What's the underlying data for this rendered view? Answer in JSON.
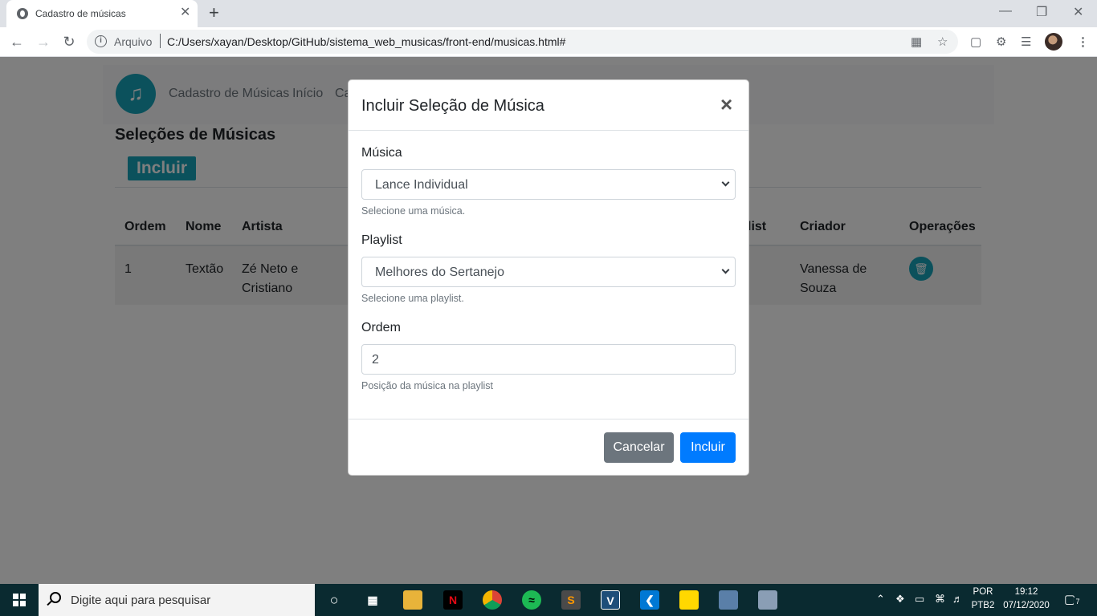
{
  "browser": {
    "tab_title": "Cadastro de músicas",
    "tab_close": "✕",
    "new_tab": "+",
    "scheme_label": "Arquivo",
    "url": "C:/Users/xayan/Desktop/GitHub/sistema_web_musicas/front-end/musicas.html#"
  },
  "navbar": {
    "brand": "Cadastro de Músicas",
    "link_inicio": "Início",
    "link_partial": "Ca"
  },
  "page": {
    "title": "Seleções de Músicas",
    "incluir_button": "Incluir"
  },
  "table": {
    "headers": [
      "Ordem",
      "Nome",
      "Artista",
      "list",
      "Criador",
      "Operações"
    ],
    "rows": [
      {
        "ordem": "1",
        "nome": "Textão",
        "artista_l1": "Zé Neto e",
        "artista_l2": "Cristiano",
        "criador_l1": "Vanessa de",
        "criador_l2": "Souza"
      }
    ]
  },
  "modal": {
    "title": "Incluir Seleção de Música",
    "close": "×",
    "musica_label": "Música",
    "musica_value": "Lance Individual",
    "musica_help": "Selecione uma música.",
    "playlist_label": "Playlist",
    "playlist_value": "Melhores do Sertanejo",
    "playlist_help": "Selecione uma playlist.",
    "ordem_label": "Ordem",
    "ordem_value": "2",
    "ordem_help": "Posição da música na playlist",
    "cancel_button": "Cancelar",
    "incluir_button": "Incluir"
  },
  "taskbar": {
    "search_placeholder": "Digite aqui para pesquisar",
    "lang_1": "POR",
    "lang_2": "PTB2",
    "time": "19:12",
    "date": "07/12/2020",
    "notifications": "7"
  }
}
